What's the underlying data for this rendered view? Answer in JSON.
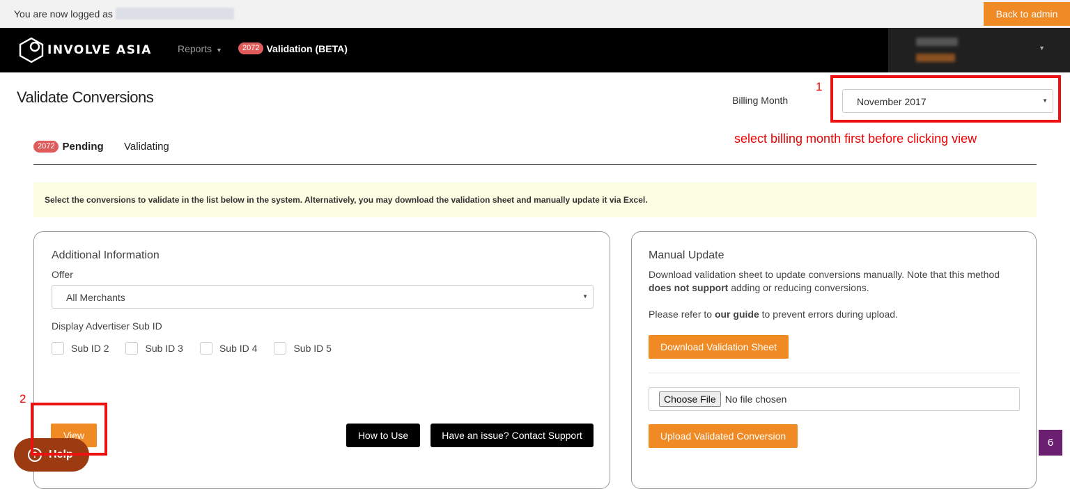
{
  "topbar": {
    "logged_text": "You are now logged as",
    "back_label": "Back to admin",
    "accent": "#f08a24"
  },
  "navbar": {
    "brand": "INVOLVE ASIA",
    "reports_label": "Reports",
    "validation_count": "2072",
    "validation_label": "Validation (BETA)"
  },
  "page": {
    "title": "Validate Conversions",
    "billing_label": "Billing Month",
    "billing_value": "November 2017",
    "annotation_1": "1",
    "annotation_note": "select billing month first before clicking view",
    "annotation_2": "2"
  },
  "tabs": {
    "pending_count": "2072",
    "pending_label": "Pending",
    "validating_label": "Validating"
  },
  "notice": "Select the conversions to validate in the list below in the system. Alternatively, you may download the validation sheet and manually update it via Excel.",
  "additional": {
    "title": "Additional Information",
    "offer_label": "Offer",
    "offer_value": "All Merchants",
    "subid_label": "Display Advertiser Sub ID",
    "subids": [
      "Sub ID 2",
      "Sub ID 3",
      "Sub ID 4",
      "Sub ID 5"
    ],
    "view_label": "View",
    "how_label": "How to Use",
    "support_label": "Have an issue? Contact Support"
  },
  "manual": {
    "title": "Manual Update",
    "desc_start": "Download validation sheet to update conversions manually. Note that this method",
    "desc_bold": "does not support",
    "desc_end": "adding or reducing conversions.",
    "guide_start": "Please refer to",
    "guide_bold": "our guide",
    "guide_end": "to prevent errors during upload.",
    "download_label": "Download Validation Sheet",
    "choose_label": "Choose File",
    "no_file": "No file chosen",
    "upload_label": "Upload Validated Conversion"
  },
  "help_label": "Help",
  "corner_badge": "6"
}
